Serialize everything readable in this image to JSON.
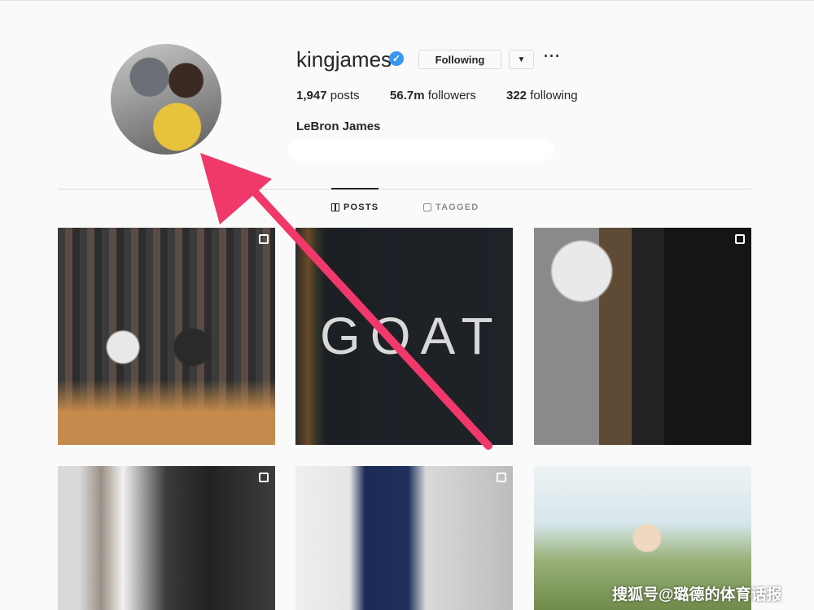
{
  "profile": {
    "username": "kingjames",
    "verified_icon": "verified-badge-icon",
    "following_label": "Following",
    "dropdown_icon": "chevron-down-icon",
    "more_icon": "more-options-icon",
    "stats": {
      "posts_count": "1,947",
      "posts_label": "posts",
      "followers_count": "56.7m",
      "followers_label": "followers",
      "following_count": "322",
      "following_label": "following"
    },
    "full_name": "LeBron James"
  },
  "tabs": {
    "posts": "POSTS",
    "tagged": "TAGGED"
  },
  "posts": {
    "goat_text": "GOAT"
  },
  "watermark": "搜狐号@璐德的体育话报",
  "colors": {
    "arrow": "#f0386b",
    "verified": "#3897f0",
    "background": "#fafafa"
  }
}
